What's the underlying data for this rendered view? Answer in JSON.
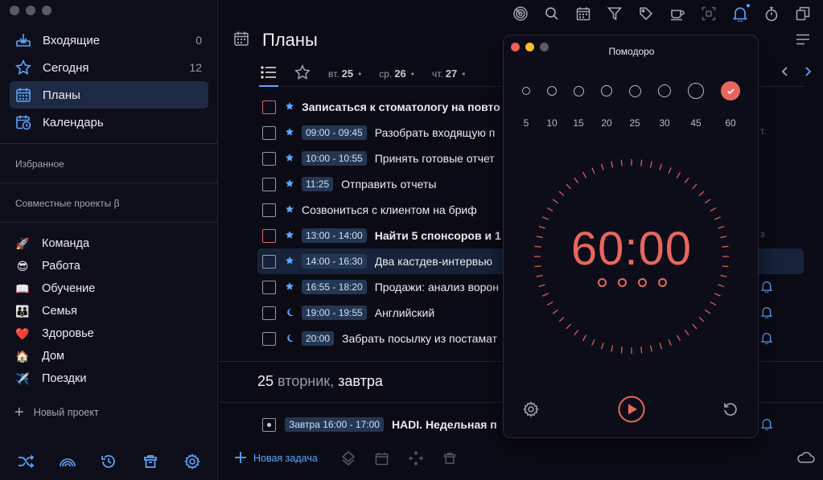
{
  "sidebar": {
    "nav": [
      {
        "label": "Входящие",
        "count": "0"
      },
      {
        "label": "Сегодня",
        "count": "12"
      },
      {
        "label": "Планы",
        "count": ""
      },
      {
        "label": "Календарь",
        "count": ""
      }
    ],
    "favorites_title": "Избранное",
    "shared_title": "Совместные проекты β",
    "projects": [
      {
        "emoji": "🚀",
        "label": "Команда"
      },
      {
        "emoji": "😎",
        "label": "Работа"
      },
      {
        "emoji": "📖",
        "label": "Обучение"
      },
      {
        "emoji": "👪",
        "label": "Семья"
      },
      {
        "emoji": "❤️",
        "label": "Здоровье"
      },
      {
        "emoji": "🏠",
        "label": "Дом"
      },
      {
        "emoji": "✈️",
        "label": "Поездки"
      }
    ],
    "new_project": "Новый проект"
  },
  "main": {
    "title": "Планы",
    "tabs": [
      {
        "wd": "вт.",
        "num": "25"
      },
      {
        "wd": "ср.",
        "num": "26"
      },
      {
        "wd": "чт.",
        "num": "27"
      }
    ],
    "tasks": [
      {
        "check": "red",
        "mark": "star",
        "time": "",
        "text": "Записаться к стоматологу на повто",
        "bold": true,
        "trail": ""
      },
      {
        "check": "",
        "mark": "star",
        "time": "09:00 - 09:45",
        "text": "Разобрать входящую п",
        "bold": false,
        "trail": "т."
      },
      {
        "check": "",
        "mark": "star",
        "time": "10:00 - 10:55",
        "text": "Принять готовые отчет",
        "bold": false,
        "trail": ""
      },
      {
        "check": "",
        "mark": "star",
        "time": "11:25",
        "text": "Отправить отчеты",
        "bold": false,
        "trail": ""
      },
      {
        "check": "",
        "mark": "star",
        "time": "",
        "text": "Созвониться с клиентом на бриф",
        "bold": false,
        "trail": ""
      },
      {
        "check": "red",
        "mark": "star",
        "time": "13:00 - 14:00",
        "text": "Найти 5 спонсоров и 1",
        "bold": true,
        "trail": "з"
      },
      {
        "check": "",
        "mark": "star",
        "time": "14:00 - 16:30",
        "text": "Два кастдев-интервью",
        "bold": false,
        "trail": ""
      },
      {
        "check": "",
        "mark": "star",
        "time": "16:55 - 18:20",
        "text": "Продажи: анализ ворон",
        "bold": false,
        "trail": ""
      },
      {
        "check": "",
        "mark": "moon",
        "time": "19:00 - 19:55",
        "text": "Английский",
        "bold": false,
        "trail": ""
      },
      {
        "check": "",
        "mark": "moon",
        "time": "20:00",
        "text": "Забрать посылку из постамат",
        "bold": false,
        "trail": ""
      }
    ],
    "day_header": {
      "num": "25",
      "wd": "вторник,",
      "rel": "завтра"
    },
    "next_task": {
      "time": "Завтра 16:00 - 17:00",
      "text": "HADI. Недельная п"
    },
    "new_task": "Новая задача"
  },
  "pomodoro": {
    "title": "Помодоро",
    "durations": [
      "5",
      "10",
      "15",
      "20",
      "25",
      "30",
      "45",
      "60"
    ],
    "selected_duration": "60",
    "timer": "60:00",
    "rounds": 4
  },
  "colors": {
    "accent": "#5aa7ff",
    "timer": "#e9665f",
    "selected": "#e9665f"
  }
}
